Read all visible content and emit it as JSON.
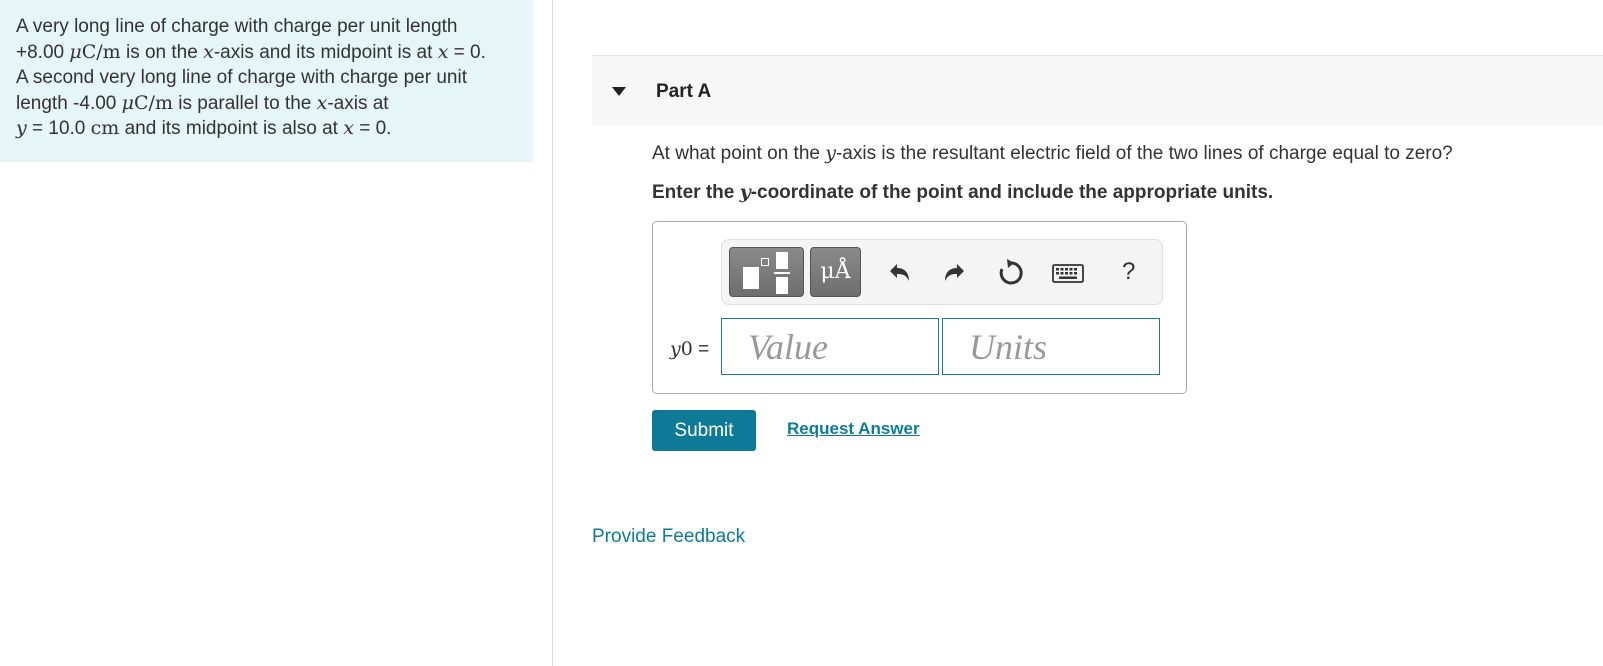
{
  "problem": {
    "line1_a": "A very long line of charge with charge per unit length",
    "line2_a": "+8.00 ",
    "mu": "μ",
    "unit_c": "C",
    "slash": "/",
    "unit_m": "m",
    "line2_b": " is on the ",
    "x_var": "x",
    "line2_c": "-axis and its midpoint is at ",
    "eq_zero_1": " = 0.",
    "line3": "A second very long line of charge with charge per unit",
    "line4_a": "length -4.00 ",
    "line4_b": " is parallel to the ",
    "line4_c": "-axis at",
    "y_var": "y",
    "line5_a": " = 10.0 ",
    "unit_cm": "cm",
    "line5_b": " and its midpoint is also at ",
    "eq_zero_2": " = 0."
  },
  "part": {
    "title": "Part A",
    "question_a": "At what point on the ",
    "question_var": "y",
    "question_b": "-axis is the resultant electric field of the two lines of charge equal to zero?",
    "instruction_a": "Enter the ",
    "instruction_var": "y",
    "instruction_b": "-coordinate of the point and include the appropriate units."
  },
  "toolbar": {
    "units_label": "μÅ",
    "help_label": "?",
    "icons": [
      "templates-icon",
      "units-icon",
      "undo-icon",
      "redo-icon",
      "reset-icon",
      "keyboard-icon",
      "help-icon"
    ]
  },
  "answer": {
    "label_var": "y",
    "label_sub": "0",
    "label_eq": " =",
    "value_placeholder": "Value",
    "units_placeholder": "Units",
    "value": "",
    "units": ""
  },
  "actions": {
    "submit_label": "Submit",
    "request_answer_label": "Request Answer",
    "feedback_label": "Provide Feedback"
  },
  "colors": {
    "panel_bg": "#e6f5f5",
    "accent": "#0d7b98",
    "header_bg": "#f7f7f7",
    "toolbar_button": "#7a7a7a"
  }
}
